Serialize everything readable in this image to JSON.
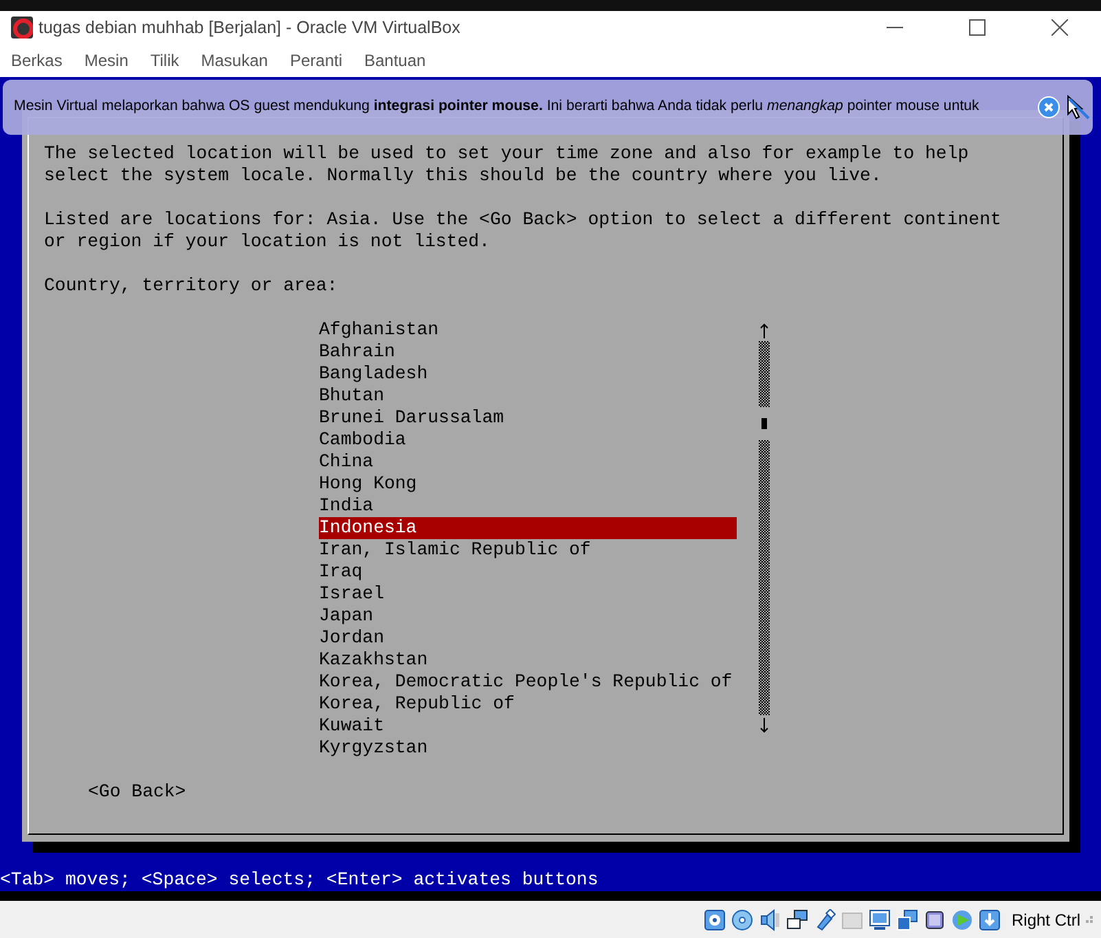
{
  "window": {
    "title": "tugas debian muhhab [Berjalan] - Oracle VM VirtualBox"
  },
  "menu": [
    "Berkas",
    "Mesin",
    "Tilik",
    "Masukan",
    "Peranti",
    "Bantuan"
  ],
  "notification": {
    "text": "Mesin Virtual melaporkan bahwa OS guest mendukung **integrasi pointer mouse.** Ini berarti bahwa Anda tidak perlu *menangkap* pointer mouse untuk"
  },
  "dialog": {
    "paragraphs": [
      "The selected location will be used to set your time zone and also for example to help\nselect the system locale. Normally this should be the country where you live.",
      "Listed are locations for: Asia. Use the <Go Back> option to select a different continent\nor region if your location is not listed."
    ],
    "prompt": "Country, territory or area:",
    "countries": [
      {
        "label": "Afghanistan",
        "selected": false
      },
      {
        "label": "Bahrain",
        "selected": false
      },
      {
        "label": "Bangladesh",
        "selected": false
      },
      {
        "label": "Bhutan",
        "selected": false
      },
      {
        "label": "Brunei Darussalam",
        "selected": false
      },
      {
        "label": "Cambodia",
        "selected": false
      },
      {
        "label": "China",
        "selected": false
      },
      {
        "label": "Hong Kong",
        "selected": false
      },
      {
        "label": "India",
        "selected": false
      },
      {
        "label": "Indonesia",
        "selected": true
      },
      {
        "label": "Iran, Islamic Republic of",
        "selected": false
      },
      {
        "label": "Iraq",
        "selected": false
      },
      {
        "label": "Israel",
        "selected": false
      },
      {
        "label": "Japan",
        "selected": false
      },
      {
        "label": "Jordan",
        "selected": false
      },
      {
        "label": "Kazakhstan",
        "selected": false
      },
      {
        "label": "Korea, Democratic People's Republic of",
        "selected": false
      },
      {
        "label": "Korea, Republic of",
        "selected": false
      },
      {
        "label": "Kuwait",
        "selected": false
      },
      {
        "label": "Kyrgyzstan",
        "selected": false
      }
    ],
    "button": "<Go Back>"
  },
  "help_line": "<Tab> moves; <Space> selects; <Enter> activates buttons",
  "status_bar": {
    "host_key": "Right Ctrl"
  }
}
